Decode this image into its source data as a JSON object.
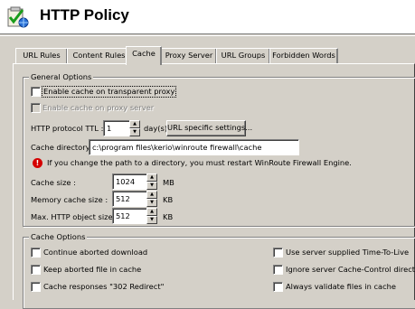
{
  "header": {
    "title": "HTTP Policy",
    "icon": "policy-checklist-icon"
  },
  "tabs": [
    {
      "label": "URL Rules",
      "active": false
    },
    {
      "label": "Content Rules",
      "active": false
    },
    {
      "label": "Cache",
      "active": true
    },
    {
      "label": "Proxy Server",
      "active": false
    },
    {
      "label": "URL Groups",
      "active": false
    },
    {
      "label": "Forbidden Words",
      "active": false
    }
  ],
  "general": {
    "legend": "General Options",
    "enable_transparent": {
      "label": "Enable cache on transparent proxy",
      "checked": false
    },
    "enable_proxy": {
      "label": "Enable cache on proxy server",
      "checked": false,
      "disabled": true
    },
    "ttl_label": "HTTP protocol TTL :",
    "ttl_value": "1",
    "ttl_unit": "day(s)",
    "url_specific_button": "URL specific settings...",
    "cache_dir_label": "Cache directory :",
    "cache_dir_value": "c:\\program files\\kerio\\winroute firewall\\cache",
    "warning": "If you change the path to a directory, you must restart WinRoute Firewall Engine.",
    "cache_size_label": "Cache size :",
    "cache_size_value": "1024",
    "cache_size_unit": "MB",
    "memory_label": "Memory cache size :",
    "memory_value": "512",
    "memory_unit": "KB",
    "max_obj_label": "Max. HTTP object size :",
    "max_obj_value": "512",
    "max_obj_unit": "KB"
  },
  "cache_options": {
    "legend": "Cache Options",
    "continue_aborted": {
      "label": "Continue aborted download",
      "checked": false
    },
    "keep_aborted": {
      "label": "Keep aborted file in cache",
      "checked": false
    },
    "cache_302": {
      "label": "Cache responses \"302 Redirect\"",
      "checked": false
    },
    "use_server_ttl": {
      "label": "Use server supplied Time-To-Live",
      "checked": false
    },
    "ignore_cc": {
      "label": "Ignore server Cache-Control directive",
      "checked": false
    },
    "always_validate": {
      "label": "Always validate files in cache",
      "checked": false
    }
  }
}
